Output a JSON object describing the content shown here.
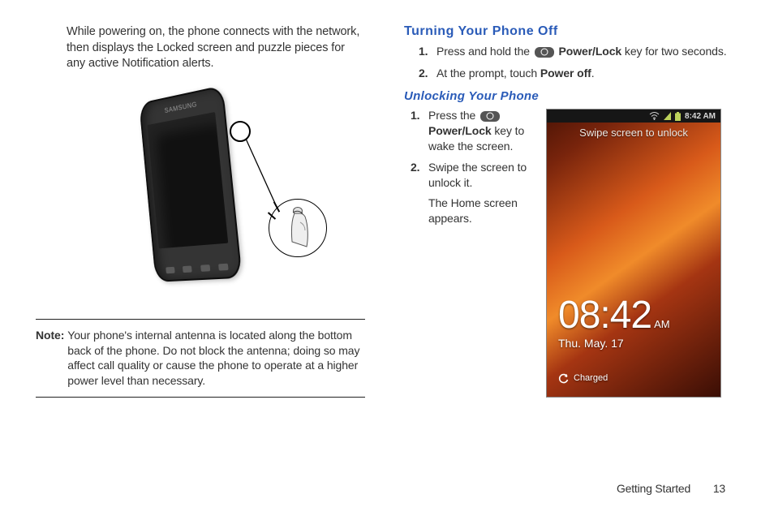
{
  "left": {
    "intro": "While powering on, the phone connects with the network, then displays the Locked screen and puzzle pieces for any active Notification alerts.",
    "phone_brand": "SAMSUNG",
    "note_label": "Note:",
    "note_text": "Your phone's internal antenna is located along the bottom back of the phone. Do not block the antenna; doing so may affect call quality or cause the phone to operate at a higher power level than necessary."
  },
  "right": {
    "h_off": "Turning Your Phone Off",
    "off_steps": [
      {
        "num": "1.",
        "pre": "Press and hold the ",
        "bold": "Power/Lock",
        "post": " key for two seconds."
      },
      {
        "num": "2.",
        "pre": "At the prompt, touch ",
        "bold": "Power off",
        "post": "."
      }
    ],
    "h_unlock": "Unlocking Your Phone",
    "unlock_steps": [
      {
        "num": "1.",
        "pre": "Press the ",
        "bold": "Power/Lock",
        "post": " key to wake the screen."
      },
      {
        "num": "2.",
        "pre": "Swipe the screen to unlock it.",
        "bold": "",
        "post": "",
        "sub": "The Home screen appears."
      }
    ]
  },
  "lockscreen": {
    "status_time": "8:42 AM",
    "swipe_text": "Swipe screen to unlock",
    "clock_time": "08:42",
    "clock_ampm": "AM",
    "date": "Thu. May. 17",
    "charged": "Charged"
  },
  "footer": {
    "section": "Getting Started",
    "page": "13"
  }
}
